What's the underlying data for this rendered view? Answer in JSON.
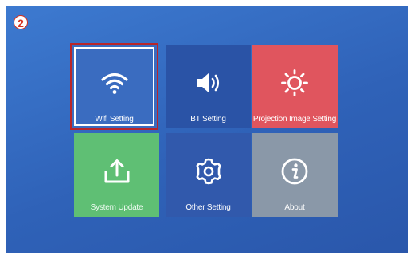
{
  "step_badge": "2",
  "tiles": [
    {
      "id": "wifi",
      "label": "Wifi Setting",
      "icon": "wifi-icon",
      "color": "#3a6cc0",
      "selected": true
    },
    {
      "id": "bt",
      "label": "BT Setting",
      "icon": "speaker-icon",
      "color": "#2a53a6",
      "selected": false
    },
    {
      "id": "projection",
      "label": "Projection Image Setting",
      "icon": "brightness-icon",
      "color": "#e0555e",
      "selected": false
    },
    {
      "id": "update",
      "label": "System Update",
      "icon": "upload-icon",
      "color": "#5fbf74",
      "selected": false
    },
    {
      "id": "other",
      "label": "Other Setting",
      "icon": "gear-icon",
      "color": "#3159ac",
      "selected": false
    },
    {
      "id": "about",
      "label": "About",
      "icon": "info-icon",
      "color": "#8a98a8",
      "selected": false
    }
  ],
  "colors": {
    "background": "#3369c0",
    "selection_border": "#b8262a",
    "badge_red": "#d6321f"
  }
}
